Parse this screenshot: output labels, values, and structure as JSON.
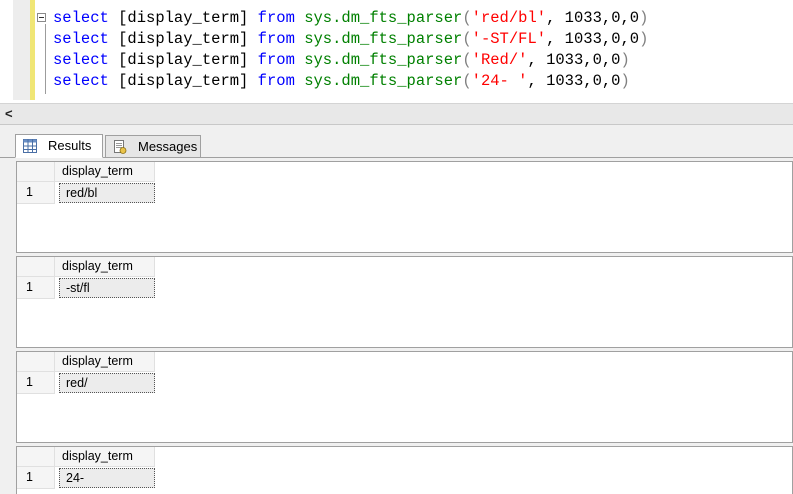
{
  "editor": {
    "lines": [
      {
        "kw1": "select",
        "col": "[display_term]",
        "kw2": "from",
        "fn": "sys.dm_fts_parser",
        "open": "(",
        "str": "'red/bl'",
        "args": ", 1033,0,0",
        "close": ")"
      },
      {
        "kw1": "select",
        "col": "[display_term]",
        "kw2": "from",
        "fn": "sys.dm_fts_parser",
        "open": "(",
        "str": "'-ST/FL'",
        "args": ", 1033,0,0",
        "close": ")"
      },
      {
        "kw1": "select",
        "col": "[display_term]",
        "kw2": "from",
        "fn": "sys.dm_fts_parser",
        "open": "(",
        "str": "'Red/'",
        "args": ", 1033,0,0",
        "close": ")"
      },
      {
        "kw1": "select",
        "col": "[display_term]",
        "kw2": "from",
        "fn": "sys.dm_fts_parser",
        "open": "(",
        "str": "'24- '",
        "args": ", 1033,0,0",
        "close": ")"
      }
    ]
  },
  "scrollbar": {
    "left_arrow": "<"
  },
  "tabs": {
    "results_label": "Results",
    "messages_label": "Messages"
  },
  "result_grids": [
    {
      "column": "display_term",
      "row_number": "1",
      "value": "red/bl"
    },
    {
      "column": "display_term",
      "row_number": "1",
      "value": "-st/fl"
    },
    {
      "column": "display_term",
      "row_number": "1",
      "value": "red/"
    },
    {
      "column": "display_term",
      "row_number": "1",
      "value": "24-"
    }
  ],
  "colors": {
    "keyword": "#0000ff",
    "system_function": "#008000",
    "string_literal": "#ff0000",
    "operator": "#808080"
  }
}
